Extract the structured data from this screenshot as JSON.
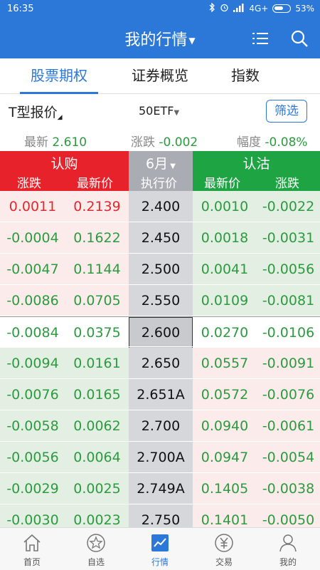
{
  "status": {
    "time": "16:35",
    "network": "4G+",
    "battery": "53%"
  },
  "header": {
    "title": "我的行情",
    "icons": [
      "list-icon",
      "search-icon"
    ]
  },
  "tabs": [
    {
      "label": "股票期权",
      "active": true
    },
    {
      "label": "证券概览",
      "active": false
    },
    {
      "label": "指数",
      "active": false
    }
  ],
  "filter": {
    "quote_mode": "T型报价",
    "underlying": "50ETF",
    "screen_button": "筛选"
  },
  "summary": {
    "latest_label": "最新",
    "latest_value": "2.610",
    "change_label": "涨跌",
    "change_value": "-0.002",
    "pct_label": "幅度",
    "pct_value": "-0.08%"
  },
  "columns": {
    "call_label": "认购",
    "put_label": "认沽",
    "month_label": "6月",
    "call_change": "涨跌",
    "call_price": "最新价",
    "strike": "执行价",
    "put_price": "最新价",
    "put_change": "涨跌"
  },
  "colors": {
    "brand": "#2b78d8",
    "call": "#e8222a",
    "put": "#1ea443",
    "up": "#e1282d",
    "down": "#2c9b3f"
  },
  "rows": [
    {
      "call_change": "0.0011",
      "call_price": "0.2139",
      "strike": "2.400",
      "put_price": "0.0010",
      "put_change": "-0.0022",
      "call_dir": "up",
      "put_dir": "down",
      "call_itm": true,
      "put_itm": false
    },
    {
      "call_change": "-0.0004",
      "call_price": "0.1622",
      "strike": "2.450",
      "put_price": "0.0018",
      "put_change": "-0.0031",
      "call_dir": "down",
      "put_dir": "down",
      "call_itm": true,
      "put_itm": false
    },
    {
      "call_change": "-0.0047",
      "call_price": "0.1144",
      "strike": "2.500",
      "put_price": "0.0041",
      "put_change": "-0.0056",
      "call_dir": "down",
      "put_dir": "down",
      "call_itm": true,
      "put_itm": false
    },
    {
      "call_change": "-0.0086",
      "call_price": "0.0705",
      "strike": "2.550",
      "put_price": "0.0109",
      "put_change": "-0.0081",
      "call_dir": "down",
      "put_dir": "down",
      "call_itm": true,
      "put_itm": false
    },
    {
      "call_change": "-0.0084",
      "call_price": "0.0375",
      "strike": "2.600",
      "put_price": "0.0270",
      "put_change": "-0.0106",
      "call_dir": "down",
      "put_dir": "down",
      "current": true
    },
    {
      "call_change": "-0.0094",
      "call_price": "0.0161",
      "strike": "2.650",
      "put_price": "0.0557",
      "put_change": "-0.0091",
      "call_dir": "down",
      "put_dir": "down",
      "call_itm": false,
      "put_itm": true
    },
    {
      "call_change": "-0.0076",
      "call_price": "0.0165",
      "strike": "2.651A",
      "put_price": "0.0572",
      "put_change": "-0.0076",
      "call_dir": "down",
      "put_dir": "down",
      "call_itm": false,
      "put_itm": true
    },
    {
      "call_change": "-0.0058",
      "call_price": "0.0062",
      "strike": "2.700",
      "put_price": "0.0940",
      "put_change": "-0.0061",
      "call_dir": "down",
      "put_dir": "down",
      "call_itm": false,
      "put_itm": true
    },
    {
      "call_change": "-0.0056",
      "call_price": "0.0064",
      "strike": "2.700A",
      "put_price": "0.0947",
      "put_change": "-0.0054",
      "call_dir": "down",
      "put_dir": "down",
      "call_itm": false,
      "put_itm": true
    },
    {
      "call_change": "-0.0029",
      "call_price": "0.0025",
      "strike": "2.749A",
      "put_price": "0.1405",
      "put_change": "-0.0038",
      "call_dir": "down",
      "put_dir": "down",
      "call_itm": false,
      "put_itm": true
    },
    {
      "call_change": "-0.0030",
      "call_price": "0.0023",
      "strike": "2.750",
      "put_price": "0.1401",
      "put_change": "-0.0050",
      "call_dir": "down",
      "put_dir": "down",
      "call_itm": false,
      "put_itm": true
    }
  ],
  "bottom_nav": [
    {
      "label": "首页",
      "icon": "home-icon",
      "active": false
    },
    {
      "label": "自选",
      "icon": "star-icon",
      "active": false
    },
    {
      "label": "行情",
      "icon": "chart-icon",
      "active": true
    },
    {
      "label": "交易",
      "icon": "yen-icon",
      "active": false
    },
    {
      "label": "我的",
      "icon": "user-icon",
      "active": false
    }
  ]
}
